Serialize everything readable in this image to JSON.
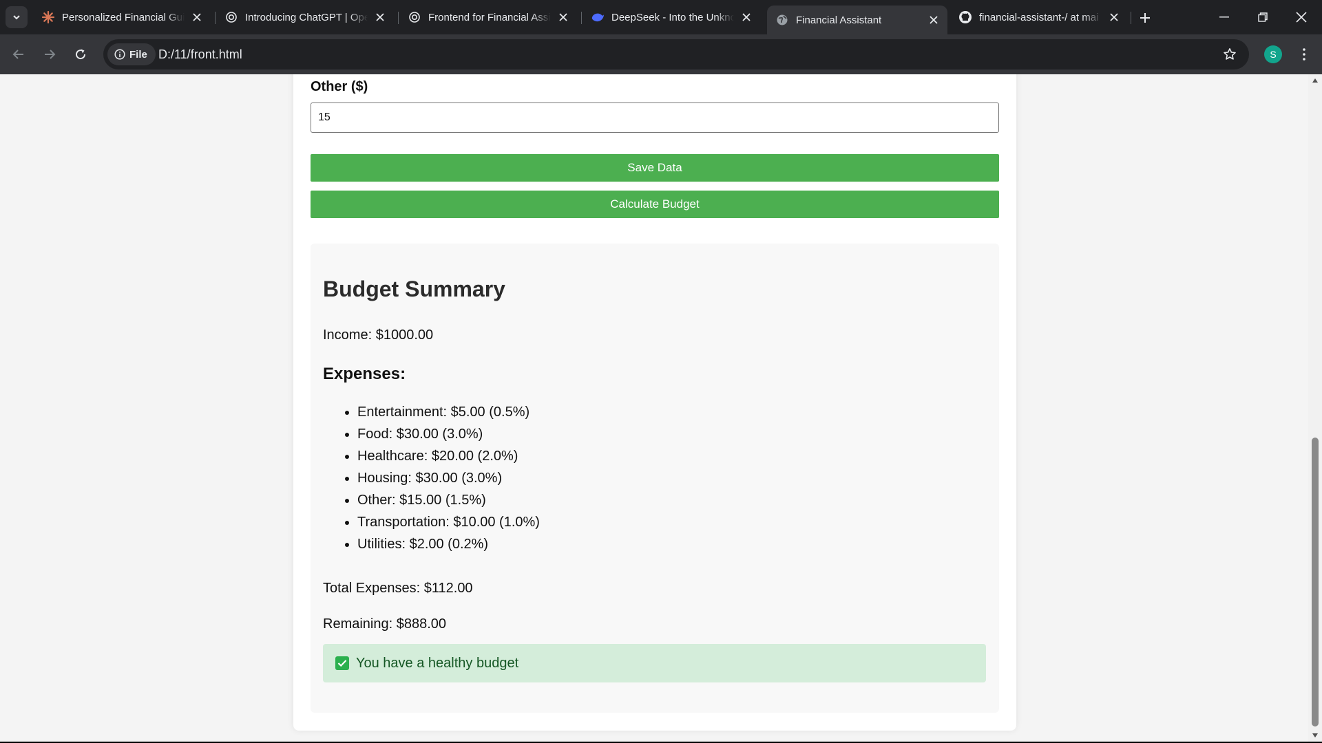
{
  "browser": {
    "tabs": [
      {
        "title": "Personalized Financial Guid",
        "icon": "claude-logo-icon"
      },
      {
        "title": "Introducing ChatGPT | Ope",
        "icon": "openai-logo-icon"
      },
      {
        "title": "Frontend for Financial Assi",
        "icon": "openai-logo-icon"
      },
      {
        "title": "DeepSeek - Into the Unkno",
        "icon": "deepseek-logo-icon"
      },
      {
        "title": "Financial Assistant",
        "icon": "globe-icon",
        "active": true
      },
      {
        "title": "financial-assistant-/ at mai",
        "icon": "github-logo-icon"
      }
    ],
    "address": {
      "chip_label": "File",
      "url": "D:/11/front.html"
    },
    "profile_initial": "S",
    "accent": "#12a58d"
  },
  "form": {
    "other_label": "Other ($)",
    "other_value": "15",
    "save_label": "Save Data",
    "calculate_label": "Calculate Budget",
    "button_color": "#4caf50"
  },
  "summary": {
    "title": "Budget Summary",
    "income": "Income: $1000.00",
    "expenses_heading": "Expenses:",
    "expenses": [
      "Entertainment: $5.00 (0.5%)",
      "Food: $30.00 (3.0%)",
      "Healthcare: $20.00 (2.0%)",
      "Housing: $30.00 (3.0%)",
      "Other: $15.00 (1.5%)",
      "Transportation: $10.00 (1.0%)",
      "Utilities: $2.00 (0.2%)"
    ],
    "total": "Total Expenses: $112.00",
    "remaining": "Remaining: $888.00",
    "status_message": "You have a healthy budget",
    "status_color": "#d4edda"
  }
}
